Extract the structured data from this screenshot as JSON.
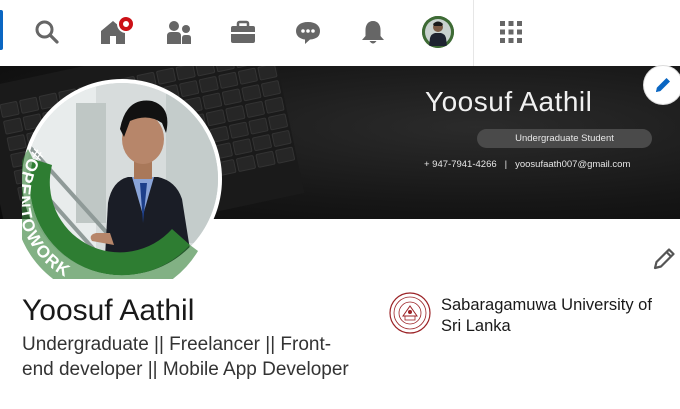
{
  "nav": {
    "items": [
      {
        "name": "search",
        "icon": "search-icon"
      },
      {
        "name": "home",
        "icon": "home-icon",
        "badge": true
      },
      {
        "name": "my-network",
        "icon": "people-icon"
      },
      {
        "name": "jobs",
        "icon": "briefcase-icon"
      },
      {
        "name": "messaging",
        "icon": "chat-icon"
      },
      {
        "name": "notifications",
        "icon": "bell-icon"
      },
      {
        "name": "me",
        "icon": "avatar"
      },
      {
        "name": "work",
        "icon": "grid-icon"
      }
    ]
  },
  "banner": {
    "name": "Yoosuf Aathil",
    "title": "Undergraduate Student",
    "phone": "+ 947-7941-4266",
    "separator": "|",
    "email": "yoosufaath007@gmail.com"
  },
  "profile": {
    "frame_text": "#OPENTOWORK",
    "name": "Yoosuf Aathil",
    "headline": "Undergraduate || Freelancer || Front-end developer || Mobile App Developer"
  },
  "education": {
    "school": "Sabaragamuwa University of Sri Lanka"
  },
  "colors": {
    "accent": "#0a66c2",
    "open_to_work": "#2e7d32",
    "badge": "#cc1016",
    "banner_bg": "#161616"
  }
}
